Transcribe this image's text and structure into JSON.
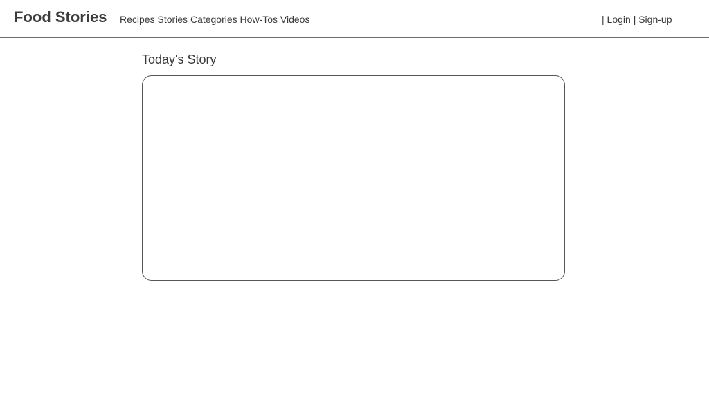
{
  "header": {
    "brand": "Food Stories",
    "nav": [
      "Recipes",
      "Stories",
      "Categories",
      "How-Tos",
      "Videos"
    ],
    "auth": {
      "separator": "|",
      "login": "Login",
      "signup": "Sign-up"
    }
  },
  "main": {
    "section_title": "Today's Story"
  },
  "colors": {
    "text": "#3a3a3a",
    "rule": "#6e6e6e",
    "box_border": "#555555"
  }
}
